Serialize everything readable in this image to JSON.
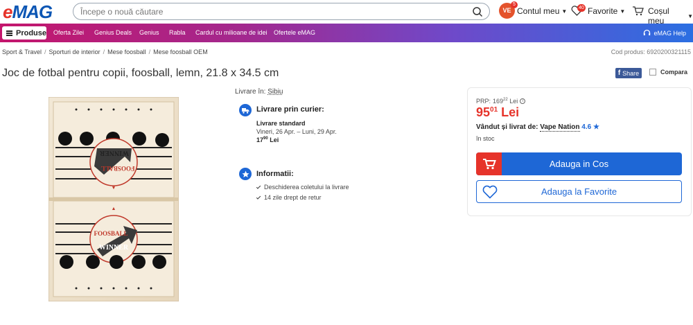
{
  "brand": {
    "logo_e": "e",
    "logo_rest": "MAG",
    "accent": "#1e67d6",
    "red": "#e6332a"
  },
  "header": {
    "search_placeholder": "Începe o nouă căutare",
    "account_initials": "VE",
    "account_badge": "5",
    "account_label": "Contul meu",
    "favorites_badge": "40",
    "favorites_label": "Favorite",
    "cart_label": "Coșul meu"
  },
  "nav": {
    "produse": "Produse",
    "links": [
      "Oferta Zilei",
      "Genius Deals",
      "Genius",
      "Rabla",
      "Cardul cu milioane de idei",
      "Ofertele eMAG"
    ],
    "help": "eMAG Help"
  },
  "breadcrumb": [
    "Sport & Travel",
    "Sporturi de interior",
    "Mese foosball",
    "Mese foosball OEM"
  ],
  "product_code": {
    "label": "Cod produs:",
    "value": "6920200321115"
  },
  "product": {
    "title": "Joc de fotbal pentru copii, foosball, lemn, 21.8 x 34.5 cm",
    "share": "Share",
    "compare": "Compara",
    "image_text_top": "WINNER",
    "image_text_top2": "FOOSBALL",
    "image_text_bottom": "FOOSBALL",
    "image_text_bottom2": "WINNER"
  },
  "delivery": {
    "livrare_in_label": "Livrare în:",
    "livrare_in_city": "Sibiu",
    "courier_title": "Livrare prin curier:",
    "standard": "Livrare standard",
    "dates": "Vineri, 26 Apr. – Luni, 29 Apr.",
    "cost_int": "17",
    "cost_dec": "90",
    "cost_cur": "Lei",
    "info_title": "Informatii:",
    "info_items": [
      "Deschiderea coletului la livrare",
      "14 zile drept de retur"
    ]
  },
  "buybox": {
    "rrp_label": "PRP:",
    "rrp_int": "169",
    "rrp_dec": "22",
    "rrp_cur": "Lei",
    "price_int": "95",
    "price_dec": "01",
    "price_cur": "Lei",
    "sold_label": "Vândut și livrat de:",
    "seller": "Vape Nation",
    "rating": "4.6",
    "stock": "în stoc",
    "add_cart": "Adauga in Cos",
    "add_fav": "Adauga la Favorite"
  }
}
